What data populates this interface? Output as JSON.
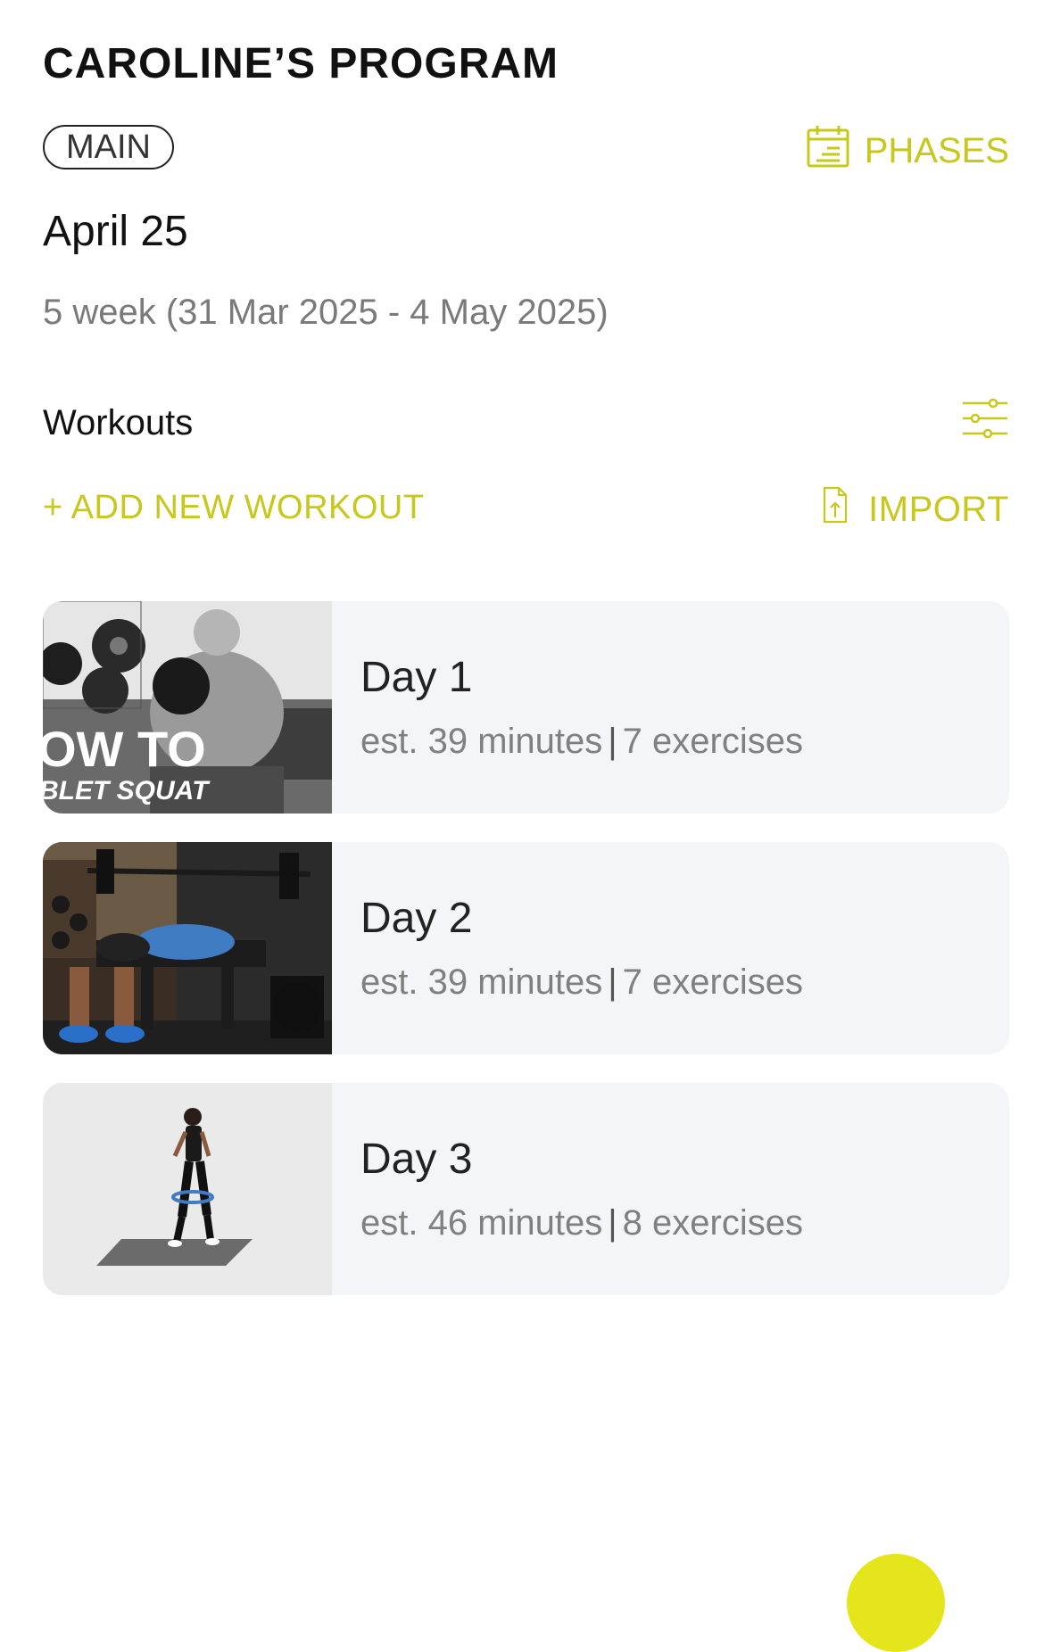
{
  "header": {
    "title": "CAROLINE’S PROGRAM",
    "program_type": "MAIN",
    "phases_label": "PHASES"
  },
  "phase": {
    "name": "April 25",
    "range": "5 week (31 Mar 2025 - 4 May 2025)"
  },
  "workouts": {
    "section_label": "Workouts",
    "add_label": "+ ADD NEW WORKOUT",
    "import_label": "IMPORT",
    "items": [
      {
        "title": "Day 1",
        "duration": "est. 39 minutes",
        "separator": "|",
        "exercises": "7 exercises",
        "thumb_overlay_line1": "OW TO",
        "thumb_overlay_line2": "BLET SQUAT"
      },
      {
        "title": "Day 2",
        "duration": "est. 39 minutes",
        "separator": "|",
        "exercises": "7 exercises"
      },
      {
        "title": "Day 3",
        "duration": "est. 46 minutes",
        "separator": "|",
        "exercises": "8 exercises"
      }
    ]
  },
  "icons": {
    "phases": "calendar-icon",
    "filter": "sliders-icon",
    "import": "file-upload-icon",
    "fab": "add-fab"
  },
  "colors": {
    "accent": "#c7c81d",
    "card_bg": "#f4f5f9",
    "fab": "#e4e51b"
  }
}
